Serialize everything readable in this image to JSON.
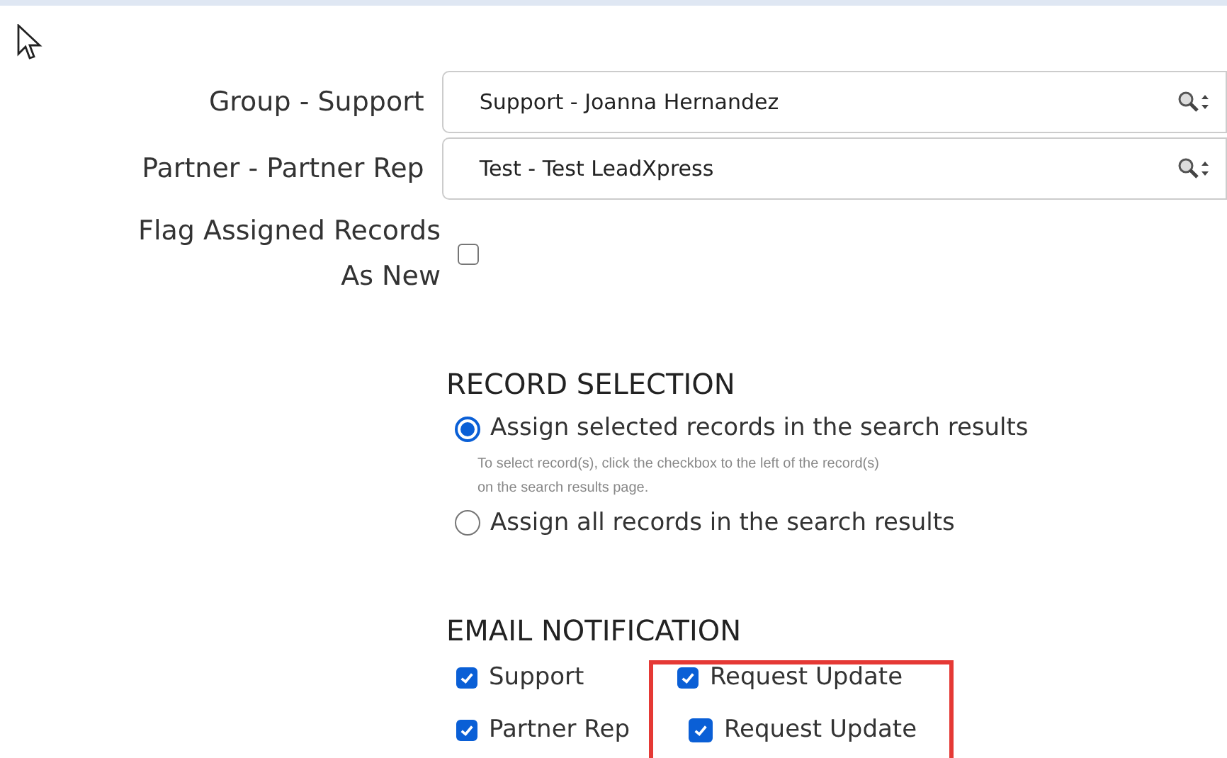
{
  "fields": [
    {
      "label": "Group - Support",
      "value": "Support - Joanna Hernandez"
    },
    {
      "label": "Partner - Partner Rep",
      "value": "Test - Test LeadXpress"
    }
  ],
  "flag_new": {
    "label_lines": [
      "Flag Assigned Records",
      "As New"
    ],
    "checked": false
  },
  "record_selection": {
    "heading": "RECORD SELECTION",
    "options": [
      {
        "label": "Assign selected records in the search results",
        "selected": true,
        "hint_lines": [
          "To select record(s), click the checkbox to the left of the record(s)",
          "on the search results page."
        ]
      },
      {
        "label": "Assign all records in the search results",
        "selected": false
      }
    ]
  },
  "email_notification": {
    "heading": "EMAIL NOTIFICATION",
    "rows": [
      {
        "label": "Support",
        "checked": true,
        "request_update": {
          "label": "Request Update",
          "checked": true
        }
      },
      {
        "label": "Partner Rep",
        "checked": true,
        "request_update": {
          "label": "Request Update",
          "checked": true
        }
      }
    ]
  }
}
